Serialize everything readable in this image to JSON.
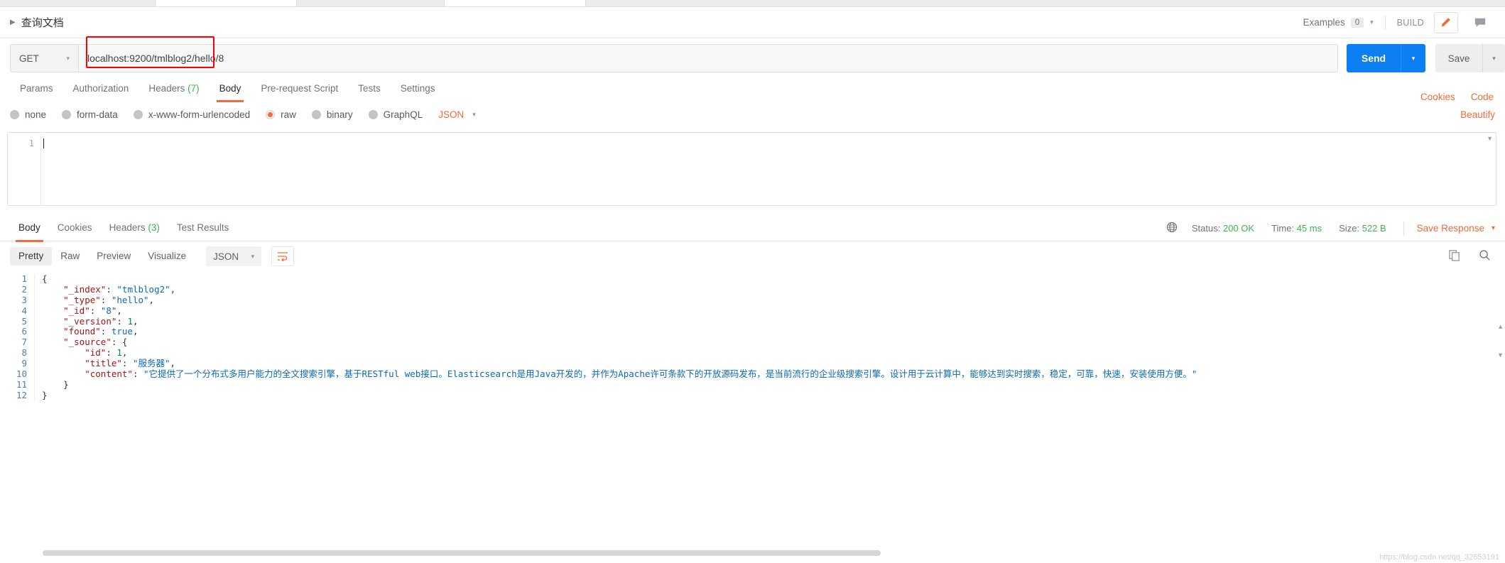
{
  "doc_header": {
    "caret_icon": "triangle-right-icon",
    "title": "查询文档",
    "examples_label": "Examples",
    "examples_count": "0",
    "examples_caret": "▾",
    "build_label": "BUILD",
    "edit_icon": "pencil-icon",
    "comment_icon": "comment-icon"
  },
  "url_bar": {
    "method": "GET",
    "method_caret": "▾",
    "url": "localhost:9200/tmlblog2/hello/8",
    "send_label": "Send",
    "send_caret": "▾",
    "save_label": "Save",
    "save_caret": "▾",
    "highlight_color": "#ff0000"
  },
  "request_tabs": {
    "items": [
      {
        "label": "Params",
        "count": "",
        "active": false
      },
      {
        "label": "Authorization",
        "count": "",
        "active": false
      },
      {
        "label": "Headers",
        "count": "(7)",
        "active": false
      },
      {
        "label": "Body",
        "count": "",
        "active": true
      },
      {
        "label": "Pre-request Script",
        "count": "",
        "active": false
      },
      {
        "label": "Tests",
        "count": "",
        "active": false
      },
      {
        "label": "Settings",
        "count": "",
        "active": false
      }
    ],
    "cookies_label": "Cookies",
    "code_label": "Code"
  },
  "body_options": {
    "radios": [
      {
        "label": "none",
        "selected": false
      },
      {
        "label": "form-data",
        "selected": false
      },
      {
        "label": "x-www-form-urlencoded",
        "selected": false
      },
      {
        "label": "raw",
        "selected": true
      },
      {
        "label": "binary",
        "selected": false
      },
      {
        "label": "GraphQL",
        "selected": false
      }
    ],
    "format": "JSON",
    "format_caret": "▾",
    "beautify_label": "Beautify"
  },
  "request_editor": {
    "line_numbers": [
      "1"
    ],
    "content": ""
  },
  "response_tabs": {
    "items": [
      {
        "label": "Body",
        "count": "",
        "active": true
      },
      {
        "label": "Cookies",
        "count": "",
        "active": false
      },
      {
        "label": "Headers",
        "count": "(3)",
        "active": false
      },
      {
        "label": "Test Results",
        "count": "",
        "active": false
      }
    ],
    "globe_icon": "globe-icon",
    "status_label": "Status:",
    "status_value": "200 OK",
    "time_label": "Time:",
    "time_value": "45 ms",
    "size_label": "Size:",
    "size_value": "522 B",
    "save_response_label": "Save Response",
    "save_response_caret": "▾"
  },
  "response_toolbar": {
    "views": [
      {
        "label": "Pretty",
        "active": true
      },
      {
        "label": "Raw",
        "active": false
      },
      {
        "label": "Preview",
        "active": false
      },
      {
        "label": "Visualize",
        "active": false
      }
    ],
    "format": "JSON",
    "format_caret": "▾",
    "wrap_icon": "word-wrap-icon",
    "copy_icon": "copy-icon",
    "search_icon": "search-icon"
  },
  "response_body": {
    "line_numbers": [
      "1",
      "2",
      "3",
      "4",
      "5",
      "6",
      "7",
      "8",
      "9",
      "10",
      "11",
      "12"
    ],
    "lines": [
      {
        "indent": 0,
        "tokens": [
          {
            "t": "{",
            "c": "p"
          }
        ]
      },
      {
        "indent": 1,
        "tokens": [
          {
            "t": "\"_index\"",
            "c": "k"
          },
          {
            "t": ": ",
            "c": "p"
          },
          {
            "t": "\"tmlblog2\"",
            "c": "s"
          },
          {
            "t": ",",
            "c": "p"
          }
        ]
      },
      {
        "indent": 1,
        "tokens": [
          {
            "t": "\"_type\"",
            "c": "k"
          },
          {
            "t": ": ",
            "c": "p"
          },
          {
            "t": "\"hello\"",
            "c": "s"
          },
          {
            "t": ",",
            "c": "p"
          }
        ]
      },
      {
        "indent": 1,
        "tokens": [
          {
            "t": "\"_id\"",
            "c": "k"
          },
          {
            "t": ": ",
            "c": "p"
          },
          {
            "t": "\"8\"",
            "c": "s"
          },
          {
            "t": ",",
            "c": "p"
          }
        ]
      },
      {
        "indent": 1,
        "tokens": [
          {
            "t": "\"_version\"",
            "c": "k"
          },
          {
            "t": ": ",
            "c": "p"
          },
          {
            "t": "1",
            "c": "n"
          },
          {
            "t": ",",
            "c": "p"
          }
        ]
      },
      {
        "indent": 1,
        "tokens": [
          {
            "t": "\"found\"",
            "c": "k"
          },
          {
            "t": ": ",
            "c": "p"
          },
          {
            "t": "true",
            "c": "b"
          },
          {
            "t": ",",
            "c": "p"
          }
        ]
      },
      {
        "indent": 1,
        "tokens": [
          {
            "t": "\"_source\"",
            "c": "k"
          },
          {
            "t": ": {",
            "c": "p"
          }
        ]
      },
      {
        "indent": 2,
        "tokens": [
          {
            "t": "\"id\"",
            "c": "k"
          },
          {
            "t": ": ",
            "c": "p"
          },
          {
            "t": "1",
            "c": "n"
          },
          {
            "t": ",",
            "c": "p"
          }
        ]
      },
      {
        "indent": 2,
        "tokens": [
          {
            "t": "\"title\"",
            "c": "k"
          },
          {
            "t": ": ",
            "c": "p"
          },
          {
            "t": "\"服务器\"",
            "c": "s"
          },
          {
            "t": ",",
            "c": "p"
          }
        ]
      },
      {
        "indent": 2,
        "tokens": [
          {
            "t": "\"content\"",
            "c": "k"
          },
          {
            "t": ": ",
            "c": "p"
          },
          {
            "t": "\"它提供了一个分布式多用户能力的全文搜索引擎，基于RESTful web接口。Elasticsearch是用Java开发的，并作为Apache许可条款下的开放源码发布，是当前流行的企业级搜索引擎。设计用于云计算中，能够达到实时搜索，稳定，可靠，快速，安装使用方便。\"",
            "c": "s"
          }
        ]
      },
      {
        "indent": 1,
        "tokens": [
          {
            "t": "}",
            "c": "p"
          }
        ]
      },
      {
        "indent": 0,
        "tokens": [
          {
            "t": "}",
            "c": "p"
          }
        ]
      }
    ]
  },
  "watermark": "https://blog.csdn.net/qq_32653191"
}
